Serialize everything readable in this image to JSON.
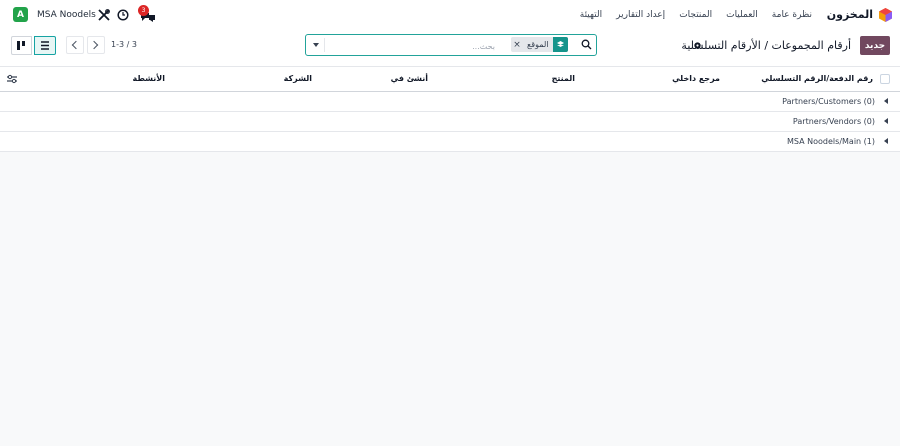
{
  "topbar": {
    "app_name": "المخزون",
    "menu": [
      "نظرة عامة",
      "العمليات",
      "المنتجات",
      "إعداد التقارير",
      "التهيئة"
    ],
    "user_initial": "A",
    "company": "MSA Noodels",
    "chat_badge": "3",
    "icons": {
      "app": "app-logo-icon",
      "tools": "tools-icon",
      "clock": "clock-icon",
      "chat": "chat-icon"
    }
  },
  "control": {
    "new_button": "جديد",
    "breadcrumb": "أرقام المجموعات / الأرقام التسلسلية",
    "search": {
      "placeholder": "بحث...",
      "facet": "الموقع"
    },
    "pager": "1-3 / 3"
  },
  "table": {
    "headers": [
      "رقم الدفعة/الرقم التسلسلي",
      "مرجع داخلي",
      "المنتج",
      "أنشئ في",
      "الشركة",
      "الأنشطة"
    ],
    "groups": [
      {
        "label": "Partners/Customers (0)"
      },
      {
        "label": "Partners/Vendors (0)"
      },
      {
        "label": "MSA Noodels/Main (1)"
      }
    ]
  },
  "colors": {
    "brand": "#71485f",
    "accent": "#22a39a",
    "user_badge": "#22a34a",
    "chat_badge": "#dc2626"
  }
}
